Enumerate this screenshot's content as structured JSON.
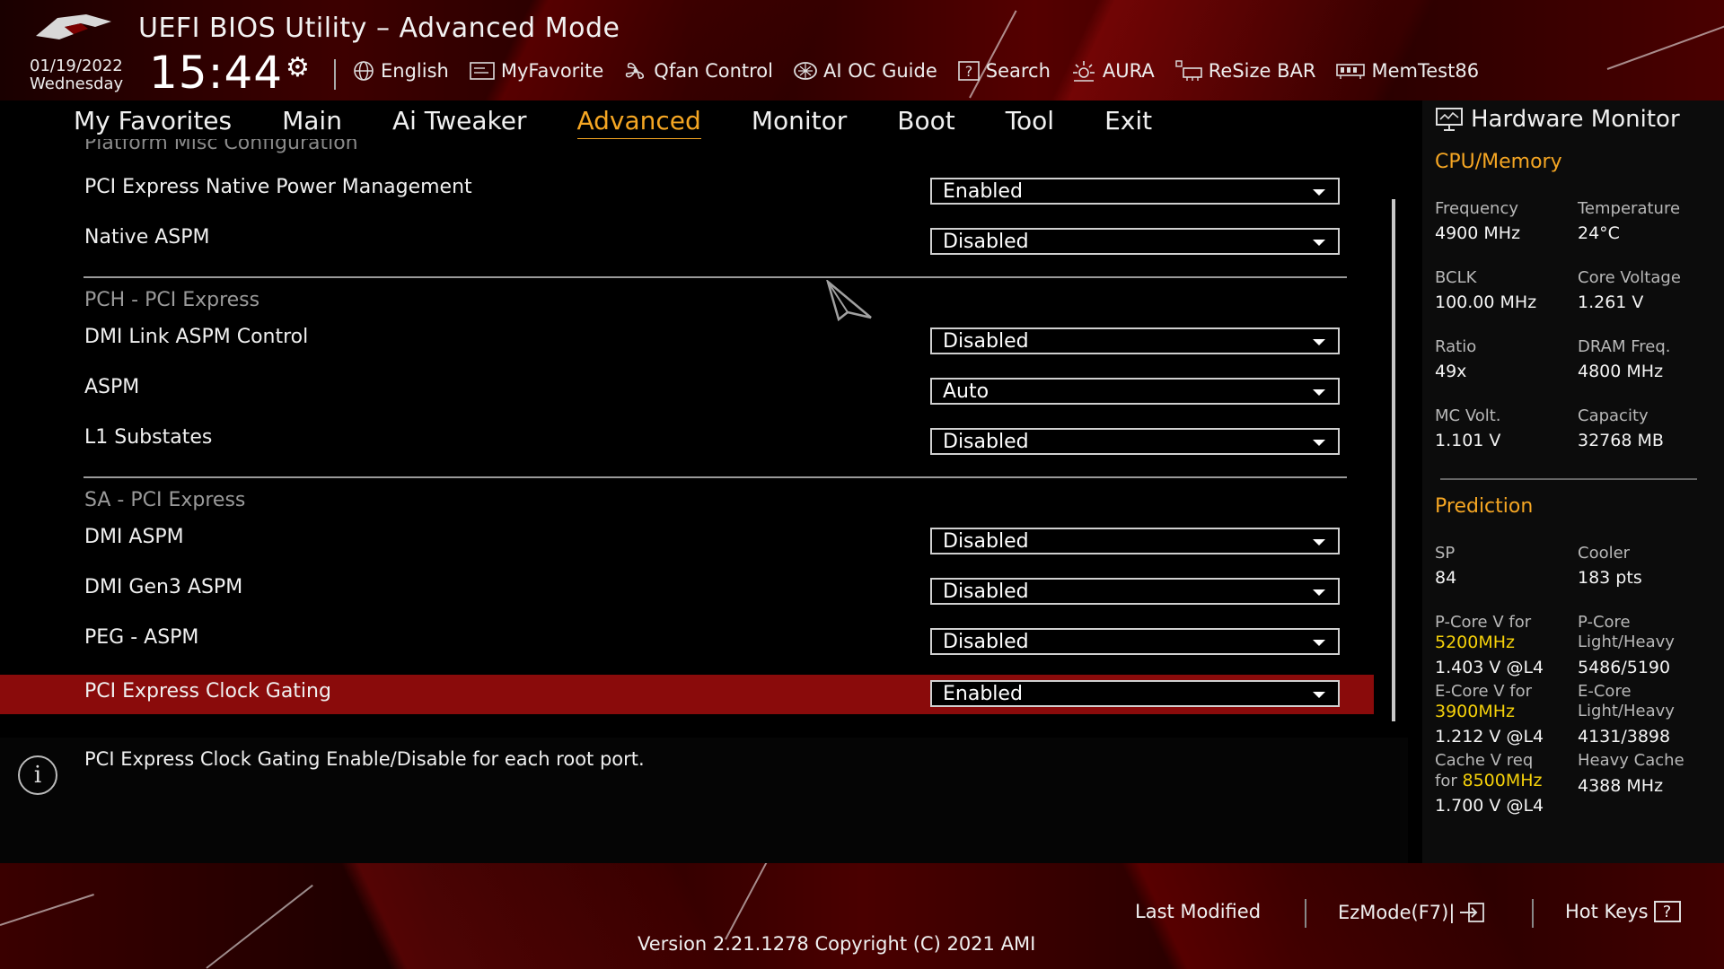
{
  "header": {
    "title": "UEFI BIOS Utility – Advanced Mode",
    "date": "01/19/2022",
    "weekday": "Wednesday",
    "time": "15:44",
    "toolbar": [
      {
        "label": "English",
        "icon": "globe-icon"
      },
      {
        "label": "MyFavorite",
        "icon": "favorite-icon"
      },
      {
        "label": "Qfan Control",
        "icon": "fan-icon"
      },
      {
        "label": "AI OC Guide",
        "icon": "ai-oc-guide-icon"
      },
      {
        "label": "Search",
        "icon": "search-help-icon"
      },
      {
        "label": "AURA",
        "icon": "aura-icon"
      },
      {
        "label": "ReSize BAR",
        "icon": "resize-bar-icon"
      },
      {
        "label": "MemTest86",
        "icon": "memtest-icon"
      }
    ]
  },
  "tabs": [
    "My Favorites",
    "Main",
    "Ai Tweaker",
    "Advanced",
    "Monitor",
    "Boot",
    "Tool",
    "Exit"
  ],
  "active_tab": "Advanced",
  "content": {
    "cut_header": "Platform Misc Configuration",
    "rows": [
      {
        "label": "PCI Express Native Power Management",
        "value": "Enabled"
      },
      {
        "label": "Native ASPM",
        "value": "Disabled"
      },
      {
        "label": "DMI Link ASPM Control",
        "value": "Disabled"
      },
      {
        "label": "ASPM",
        "value": "Auto"
      },
      {
        "label": "L1 Substates",
        "value": "Disabled"
      },
      {
        "label": "DMI ASPM",
        "value": "Disabled"
      },
      {
        "label": "DMI Gen3 ASPM",
        "value": "Disabled"
      },
      {
        "label": "PEG - ASPM",
        "value": "Disabled"
      },
      {
        "label": "PCI Express Clock Gating",
        "value": "Enabled"
      }
    ],
    "sections": [
      "PCH - PCI Express",
      "SA - PCI Express"
    ],
    "help_text": "PCI Express Clock Gating Enable/Disable for each root port."
  },
  "hardware_monitor": {
    "title": "Hardware Monitor",
    "cpu_memory_title": "CPU/Memory",
    "cpu_memory": [
      {
        "label": "Frequency",
        "value": "4900 MHz"
      },
      {
        "label": "Temperature",
        "value": "24°C"
      },
      {
        "label": "BCLK",
        "value": "100.00 MHz"
      },
      {
        "label": "Core Voltage",
        "value": "1.261 V"
      },
      {
        "label": "Ratio",
        "value": "49x"
      },
      {
        "label": "DRAM Freq.",
        "value": "4800 MHz"
      },
      {
        "label": "MC Volt.",
        "value": "1.101 V"
      },
      {
        "label": "Capacity",
        "value": "32768 MB"
      }
    ],
    "prediction_title": "Prediction",
    "prediction": {
      "sp_label": "SP",
      "sp_value": "84",
      "cooler_label": "Cooler",
      "cooler_value": "183 pts",
      "pcore_v_label": "P-Core V for",
      "pcore_v_freq": "5200MHz",
      "pcore_v_value": "1.403 V @L4",
      "pcore_lh_label1": "P-Core",
      "pcore_lh_label2": "Light/Heavy",
      "pcore_lh_value": "5486/5190",
      "ecore_v_label": "E-Core V for",
      "ecore_v_freq": "3900MHz",
      "ecore_v_value": "1.212 V @L4",
      "ecore_lh_label1": "E-Core",
      "ecore_lh_label2": "Light/Heavy",
      "ecore_lh_value": "4131/3898",
      "cache_v_label1": "Cache V req",
      "cache_v_label2": "for",
      "cache_v_freq": "8500MHz",
      "cache_v_value": "1.700 V @L4",
      "heavy_cache_label": "Heavy Cache",
      "heavy_cache_value": "4388 MHz"
    }
  },
  "footer": {
    "last_modified": "Last Modified",
    "ezmode": "EzMode(F7)|",
    "hot_keys": "Hot Keys",
    "hot_keys_key": "?",
    "version": "Version 2.21.1278 Copyright (C) 2021 AMI"
  },
  "colors": {
    "accent": "#f5a623",
    "selected_row": "#8a0b0b",
    "highlight": "#f5d10a"
  }
}
